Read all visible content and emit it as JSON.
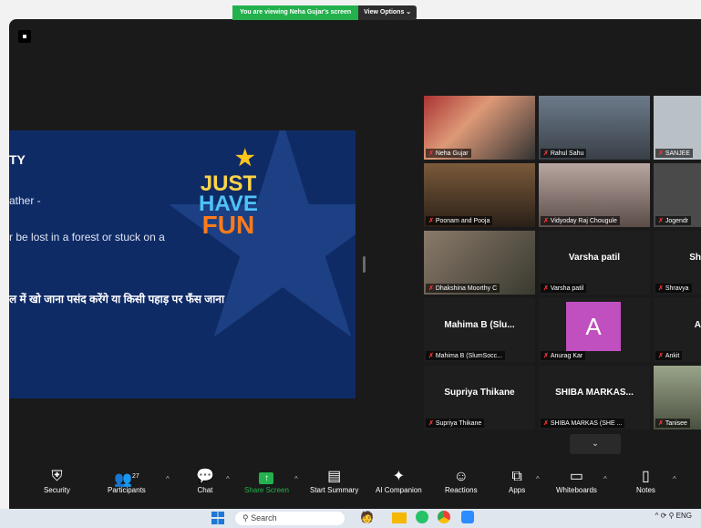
{
  "banner": {
    "viewing": "You are viewing Neha Gujar's screen",
    "options": "View Options"
  },
  "slide": {
    "title": "TY",
    "line1": "ather -",
    "line2": "r be lost in a forest or stuck on a",
    "line3": "ल में खो जाना पसंद करेंगे या किसी पहाड़ पर फँस जाना",
    "fun_just": "JUST",
    "fun_have": "HAVE",
    "fun_fun": "FUN"
  },
  "tiles": [
    {
      "name": "Neha Gujar",
      "center": ""
    },
    {
      "name": "Rahul Sahu",
      "center": ""
    },
    {
      "name": "SANJEE",
      "center": ""
    },
    {
      "name": "Poonam and Pooja",
      "center": ""
    },
    {
      "name": "Vidyoday Raj Chougule",
      "center": ""
    },
    {
      "name": "Jogendr",
      "center": ""
    },
    {
      "name": "Dhakshina Moorthy C",
      "center": ""
    },
    {
      "name": "Varsha patil",
      "center": "Varsha patil"
    },
    {
      "name": "Shravya",
      "center": "Sh"
    },
    {
      "name": "Mahima B (SlumSocc...",
      "center": "Mahima B (Slu..."
    },
    {
      "name": "Anurag Kar",
      "center": "A"
    },
    {
      "name": "Ankit",
      "center": "A"
    },
    {
      "name": "Supriya Thikane",
      "center": "Supriya Thikane"
    },
    {
      "name": "SHIBA MARKAS (SHE ...",
      "center": "SHIBA MARKAS..."
    },
    {
      "name": "Tanisee",
      "center": ""
    }
  ],
  "more": "⌄",
  "toolbar": {
    "security": "Security",
    "participants": "Participants",
    "participants_count": "27",
    "chat": "Chat",
    "share": "Share Screen",
    "summary": "Start Summary",
    "ai": "AI Companion",
    "reactions": "Reactions",
    "apps": "Apps",
    "whiteboards": "Whiteboards",
    "notes": "Notes"
  },
  "taskbar": {
    "search": "Search",
    "lang": "ENG"
  },
  "colors": {
    "accent_green": "#23b14d",
    "slide_bg": "#0f2b66",
    "avatar_purple": "#c04fc0"
  }
}
